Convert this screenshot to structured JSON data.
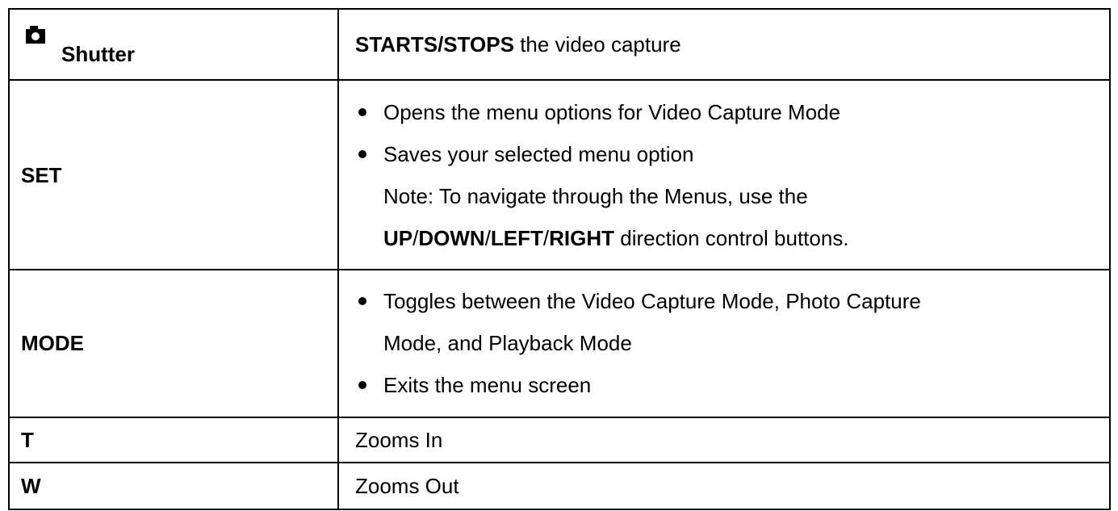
{
  "rows": {
    "shutter": {
      "icon": "camera-icon",
      "label": "Shutter",
      "desc_bold": "STARTS/STOPS",
      "desc_rest": " the video capture"
    },
    "set": {
      "label": "SET",
      "bullet1": "Opens the menu options for Video Capture Mode",
      "bullet2": "Saves your selected menu option",
      "note_line1": "Note: To navigate through the Menus, use the",
      "note_up": "UP",
      "sep1": "/",
      "note_down": "DOWN",
      "sep2": "/",
      "note_left": "LEFT",
      "sep3": "/",
      "note_right": "RIGHT",
      "note_rest": " direction control buttons."
    },
    "mode": {
      "label": "MODE",
      "bullet1_line1": "Toggles between the Video Capture Mode, Photo Capture",
      "bullet1_line2": "Mode, and Playback Mode",
      "bullet2": "Exits the menu screen"
    },
    "t": {
      "label": "T",
      "desc": "Zooms In"
    },
    "w": {
      "label": "W",
      "desc": "Zooms Out"
    }
  }
}
